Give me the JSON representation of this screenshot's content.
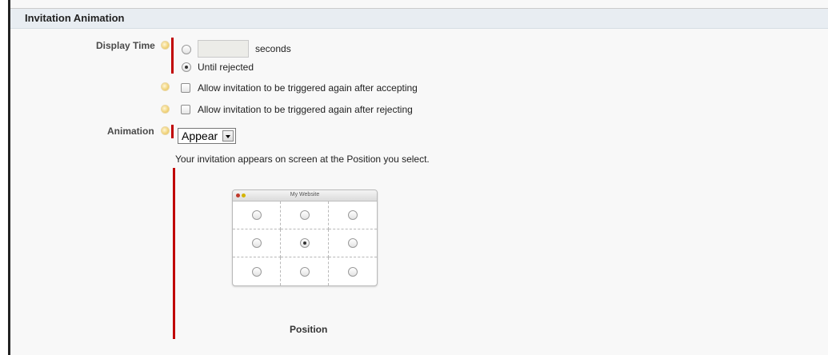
{
  "section": {
    "title": "Invitation Animation"
  },
  "display_time": {
    "label": "Display Time",
    "seconds_value": "",
    "seconds_suffix": "seconds",
    "until_rejected_label": "Until rejected",
    "selected": "until_rejected"
  },
  "options": {
    "retrigger_after_accepting": "Allow invitation to be triggered again after accepting",
    "retrigger_after_rejecting": "Allow invitation to be triggered again after rejecting"
  },
  "animation": {
    "label": "Animation",
    "selected": "Appear",
    "description": "Your invitation appears on screen at the Position you select."
  },
  "position_preview": {
    "window_title": "My Website",
    "selected_cell": "middle-center",
    "label": "Position"
  },
  "colors": {
    "required_marker": "#c00000",
    "header_bg": "#e8edf2"
  }
}
